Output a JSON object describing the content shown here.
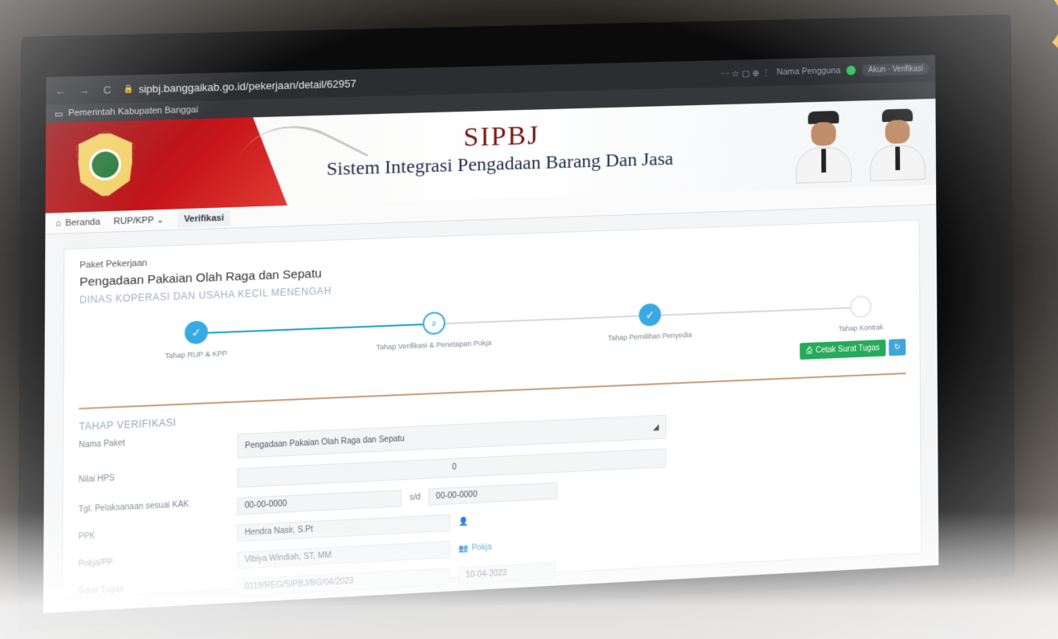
{
  "browser": {
    "url": "sipbj.banggaikab.go.id/pekerjaan/detail/62957",
    "bookmark": "Pemerintah Kabupaten Banggai",
    "nav_back": "←",
    "nav_forward": "→",
    "nav_reload": "C",
    "right_icons": "⋯ ☆ ▢ ⊕ ⋮",
    "account_text": "Nama Pengguna",
    "account_pill": "Akun · Verifikasi"
  },
  "header": {
    "title": "SIPBJ",
    "subtitle": "Sistem Integrasi Pengadaan Barang Dan Jasa"
  },
  "topnav": {
    "home": "Beranda",
    "rup": "RUP/KPP",
    "rup_caret": "⌄",
    "active": "Verifikasi"
  },
  "paket": {
    "label": "Paket Pekerjaan",
    "title": "Pengadaan Pakaian Olah Raga dan Sepatu",
    "dept": "DINAS KOPERASI DAN USAHA KECIL MENENGAH"
  },
  "steps": [
    {
      "label": "Tahap RUP & KPP",
      "state": "done",
      "icon": "✓"
    },
    {
      "label": "Tahap Verifikasi & Penetapan Pokja",
      "state": "current",
      "icon": "⌕"
    },
    {
      "label": "Tahap Pemilihan Penyedia",
      "state": "done",
      "icon": "✓"
    },
    {
      "label": "Tahap Kontrak",
      "state": "todo",
      "icon": ""
    }
  ],
  "actions": {
    "print_label": "Cetak Surat Tugas",
    "print_icon": "⎙",
    "extra_icon": "↻"
  },
  "verifikasi": {
    "section_title": "TAHAP VERIFIKASI",
    "nama_paket_label": "Nama Paket",
    "nama_paket_value": "Pengadaan Pakaian Olah Raga dan Sepatu",
    "nilai_hps_label": "Nilai HPS",
    "nilai_hps_value": "0",
    "tgl_label": "Tgl. Pelaksanaan sesuai KAK",
    "tgl_start": "00-00-0000",
    "tgl_sep": "s/d",
    "tgl_end": "00-00-0000",
    "ppk_label": "PPK",
    "ppk_value": "Hendra Nasir, S.Pt",
    "pokja_label": "Pokja/PP",
    "pokja_value": "Vibiya Windiah, ST, MM",
    "pokja_link": "Pokja",
    "surat_label": "Surat Tugas",
    "surat_value": "0119/REG/SIPBJ/BG/04/2023",
    "surat_date": "10-04-2023"
  }
}
